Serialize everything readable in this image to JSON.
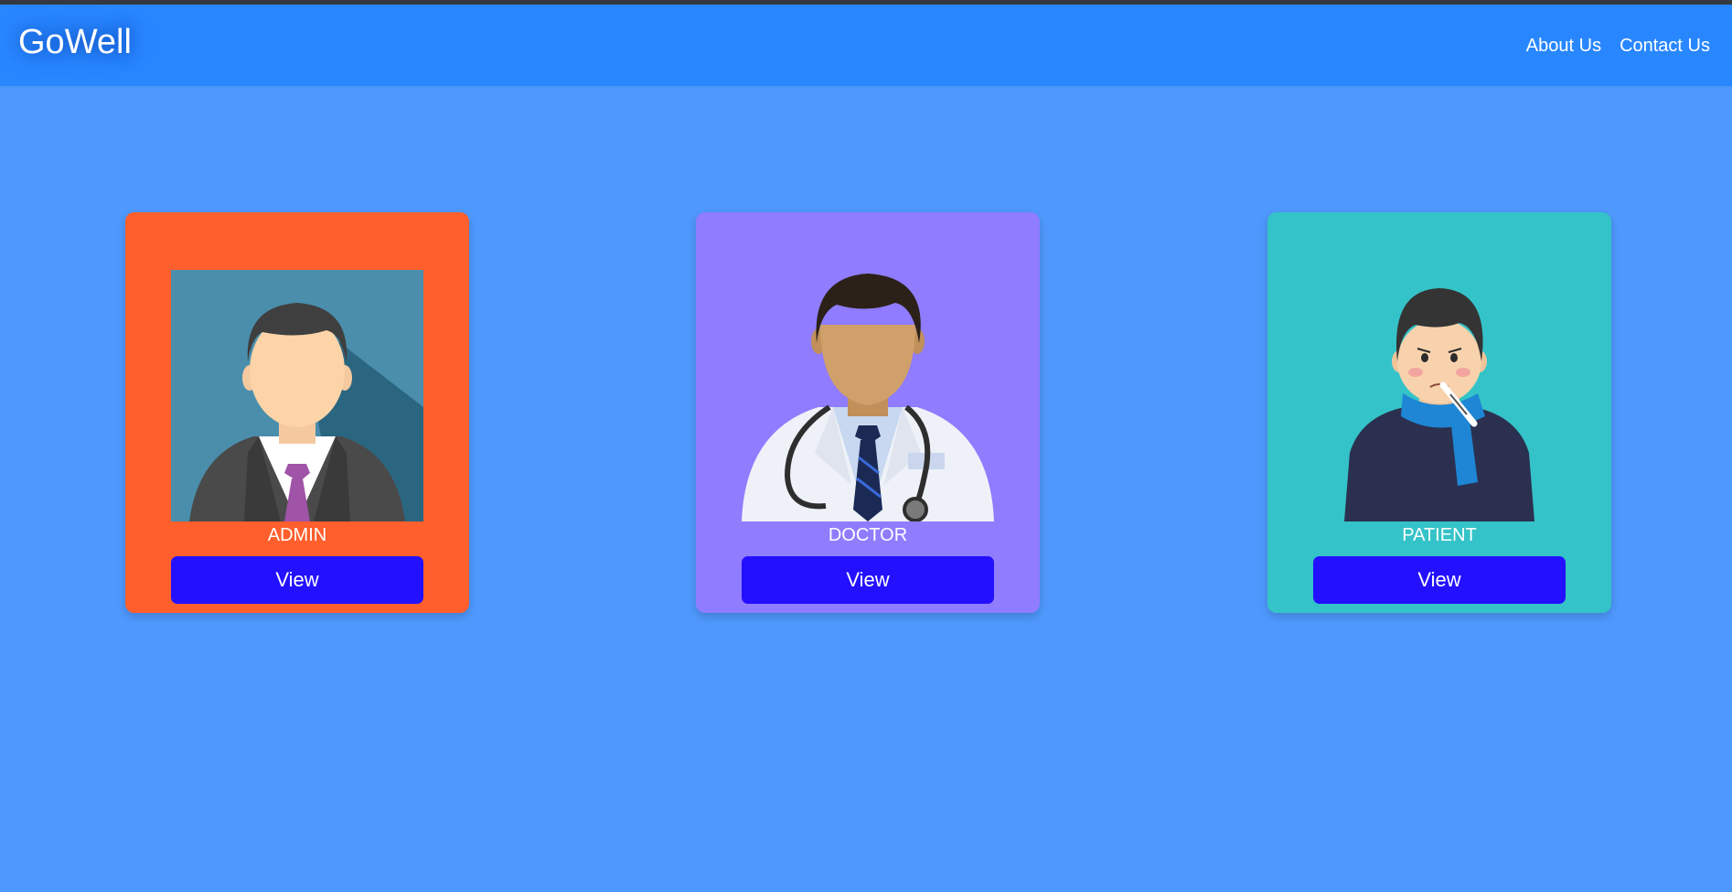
{
  "navbar": {
    "brand": "GoWell",
    "links": [
      {
        "label": "About Us"
      },
      {
        "label": "Contact Us"
      }
    ]
  },
  "colors": {
    "page_background": "#4f99fe",
    "navbar": "#2887ff",
    "button": "#2310ff"
  },
  "cards": [
    {
      "role": "ADMIN",
      "button_label": "View",
      "color": "#ff5f2d",
      "image": "admin-avatar-icon"
    },
    {
      "role": "DOCTOR",
      "button_label": "View",
      "color": "#8f7cff",
      "image": "doctor-avatar-icon"
    },
    {
      "role": "PATIENT",
      "button_label": "View",
      "color": "#34c3c8",
      "image": "patient-avatar-icon"
    }
  ]
}
